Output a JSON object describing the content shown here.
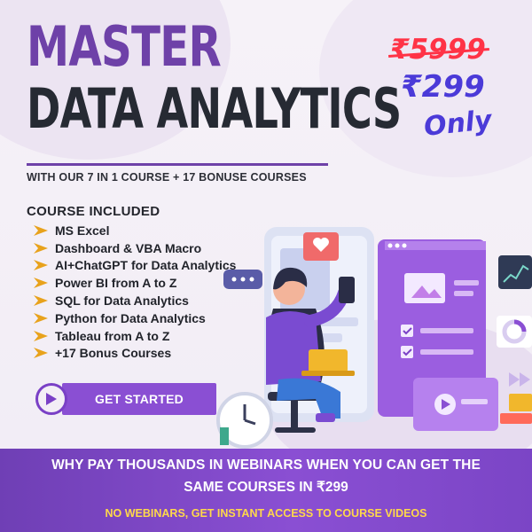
{
  "hero": {
    "title_line1": "MASTER",
    "title_line2": "DATA ANALYTICS",
    "subtitle": "WITH OUR 7 IN 1 COURSE + 17 BONUSE COURSES"
  },
  "pricing": {
    "old_price": "₹5999",
    "new_price": "₹299",
    "suffix": "Only"
  },
  "courses": {
    "heading": "COURSE INCLUDED",
    "items": [
      "MS Excel",
      "Dashboard & VBA Macro",
      "AI+ChatGPT for Data Analytics",
      "Power BI from A to Z",
      "SQL for Data Analytics",
      "Python for Data Analytics",
      "Tableau from A to Z",
      "+17 Bonus Courses"
    ]
  },
  "cta": {
    "label": "GET STARTED"
  },
  "banner": {
    "line1": "WHY PAY THOUSANDS IN WEBINARS WHEN YOU CAN GET THE",
    "line2": "SAME COURSES IN ₹299",
    "line3": "NO WEBINARS,  GET INSTANT ACCESS TO COURSE VIDEOS"
  },
  "colors": {
    "brand_purple": "#6e41a8",
    "button_purple": "#8a4fd3",
    "strike_red": "#ff3346",
    "price_blue": "#4b3ad8",
    "accent_yellow": "#ffd84a",
    "bullet_orange": "#e8a21c"
  }
}
